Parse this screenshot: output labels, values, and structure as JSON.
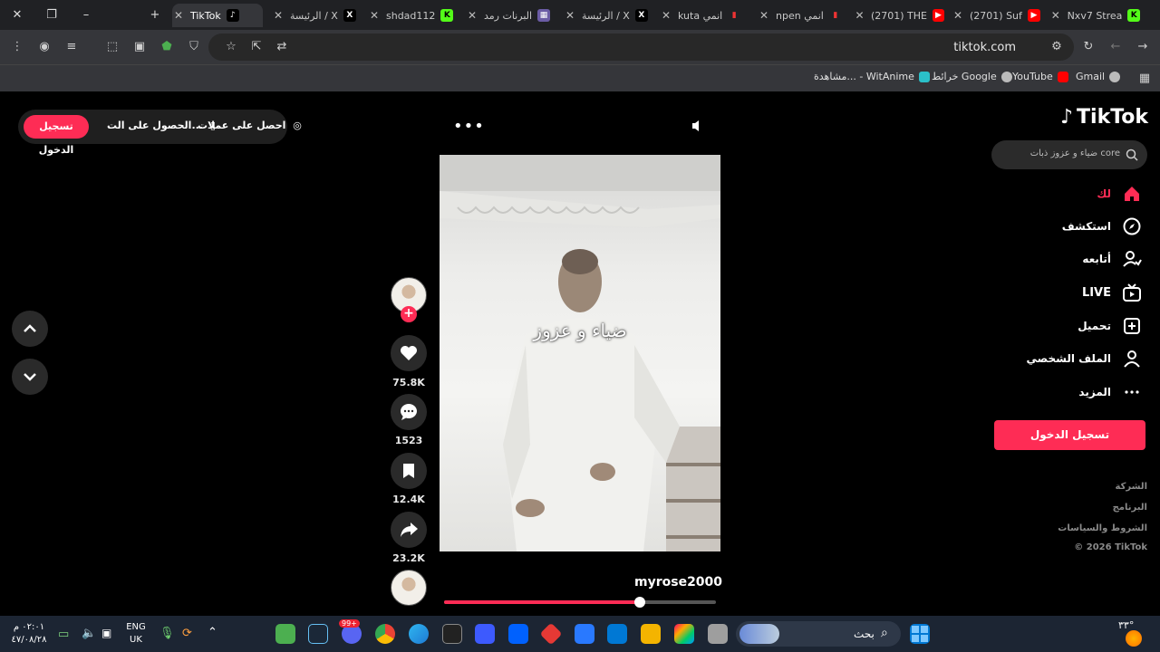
{
  "browser": {
    "tabs": [
      {
        "label": "TikTok",
        "active": true
      },
      {
        "label": "الرئيسة / X"
      },
      {
        "label": "shdad112"
      },
      {
        "label": "البرنات رمد"
      },
      {
        "label": "الرئيسة / X"
      },
      {
        "label": "kuta انمي"
      },
      {
        "label": "npen انمي"
      },
      {
        "label": "(2701) THE"
      },
      {
        "label": "(2701) Suf"
      },
      {
        "label": "Nxv7 Strea"
      }
    ],
    "url": "tiktok.com",
    "bookmarks": [
      "Gmail",
      "YouTube",
      "خرائط Google",
      "مشاهدة... - WitAnime"
    ]
  },
  "top_bar": {
    "login_label": "تسجيل الدخول",
    "get_app_label": "الحصول على الت...",
    "get_coins_label": "احصل على عملات"
  },
  "video": {
    "caption": "ضياء و عزوز",
    "username": "myrose2000",
    "progress": 0.72
  },
  "actions": {
    "likes": "75.8K",
    "comments": "1523",
    "saves": "12.4K",
    "shares": "23.2K"
  },
  "sidebar": {
    "logo": "TikTok",
    "search_placeholder": "ضياء و عزوز ذبات core",
    "nav": [
      {
        "label": "لك",
        "icon": "home-icon"
      },
      {
        "label": "استكشف",
        "icon": "compass-icon"
      },
      {
        "label": "أتابعه",
        "icon": "following-icon"
      },
      {
        "label": "LIVE",
        "icon": "live-icon"
      },
      {
        "label": "تحميل",
        "icon": "upload-icon"
      },
      {
        "label": "الملف الشخصي",
        "icon": "profile-icon"
      },
      {
        "label": "المزيد",
        "icon": "more-icon"
      }
    ],
    "login_button": "تسجيل الدخول",
    "footer": [
      "الشركة",
      "البرنامج",
      "الشروط والسياسات",
      "© 2026 TikTok"
    ]
  },
  "taskbar": {
    "time": "٠٢:٠١ م",
    "date": "٤٧/٠٨/٢٨",
    "lang_top": "ENG",
    "lang_bottom": "UK",
    "search_label": "بحث",
    "weather": "٣٣°",
    "badge": "99+"
  },
  "colors": {
    "accent": "#fe2c55",
    "page_bg": "#000000",
    "chrome_bg": "#35363a"
  }
}
